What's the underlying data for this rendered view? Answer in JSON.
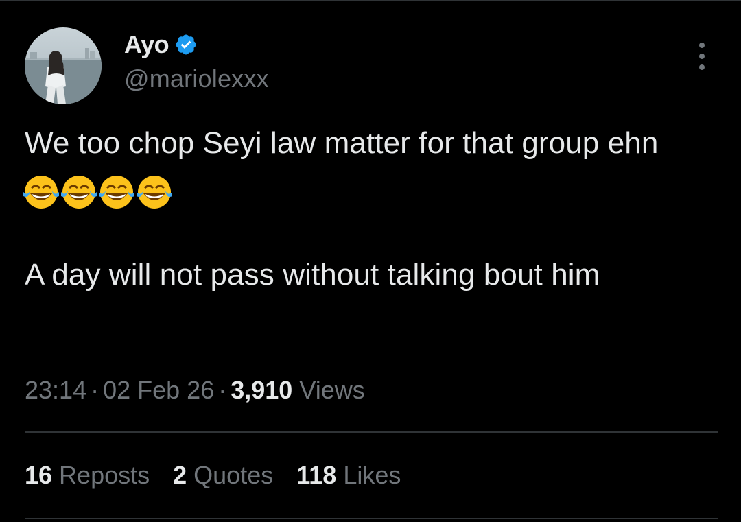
{
  "tweet": {
    "author": {
      "display_name": "Ayo",
      "handle": "@mariolexxx",
      "verified": true,
      "verified_color": "#1d9bf0"
    },
    "text": {
      "line1": "We too chop Seyi law matter for that group ehn",
      "emoji": "😂😂😂😂",
      "line2": "A day will not pass without talking bout him"
    },
    "time": "23:14",
    "date": "02 Feb 26",
    "separator": "·",
    "views_count": "3,910",
    "views_label": "Views"
  },
  "stats": {
    "reposts_count": "16",
    "reposts_label": "Reposts",
    "quotes_count": "2",
    "quotes_label": "Quotes",
    "likes_count": "118",
    "likes_label": "Likes"
  },
  "colors": {
    "background": "#000000",
    "text_primary": "#e7e9ea",
    "text_secondary": "#71767b",
    "divider": "#2f3336"
  },
  "icons": {
    "verified": "verified-badge-icon",
    "more": "more-options-icon",
    "emoji": "face-with-tears-of-joy-emoji"
  }
}
